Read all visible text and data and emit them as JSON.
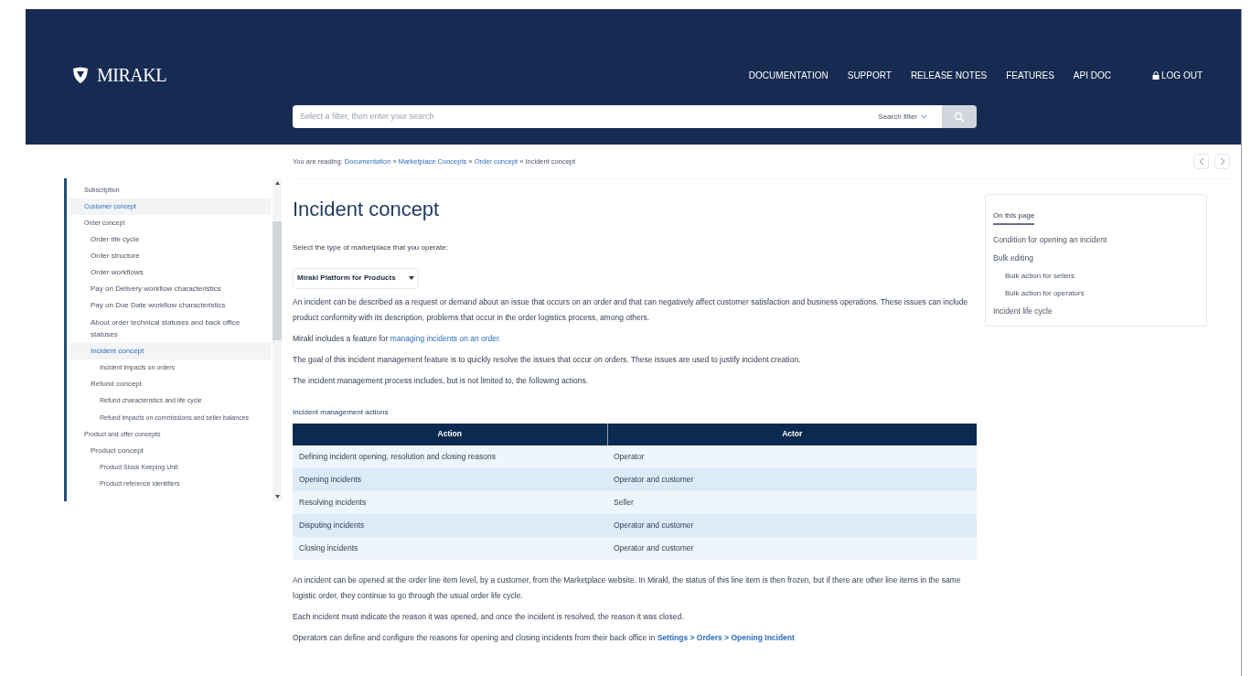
{
  "header": {
    "logo": "MIRAKL",
    "nav": [
      {
        "label": "DOCUMENTATION",
        "kind": "link"
      },
      {
        "label": "SUPPORT",
        "kind": "link"
      },
      {
        "label": "RELEASE NOTES",
        "kind": "link"
      },
      {
        "label": "FEATURES",
        "kind": "link"
      },
      {
        "label": "API DOC",
        "kind": "link"
      },
      {
        "label": "LOG OUT",
        "kind": "logout"
      }
    ],
    "search": {
      "placeholder": "Select a filter, then enter your search",
      "filter": "Search filter"
    }
  },
  "breadcrumb": {
    "prefix": "You are reading:",
    "links": [
      "Documentation",
      "Marketplace Concepts",
      "Order concept"
    ],
    "current": "Incident concept",
    "separator": "»"
  },
  "sidebar": {
    "items": [
      {
        "label": "Subscription",
        "highlighted": false
      },
      {
        "label": "Customer concept",
        "highlighted": true
      },
      {
        "label": "Order concept",
        "highlighted": false,
        "children": [
          {
            "label": "Order life cycle",
            "highlighted": false
          },
          {
            "label": "Order structure",
            "highlighted": false
          },
          {
            "label": "Order workflows",
            "highlighted": false
          },
          {
            "label": "Pay on Delivery workflow characteristics",
            "highlighted": false
          },
          {
            "label": "Pay on Due Date workflow characteristics",
            "highlighted": false
          },
          {
            "label": "About order technical statuses and back office statuses",
            "highlighted": false
          },
          {
            "label": "Incident concept",
            "highlighted": true,
            "children": [
              {
                "label": "Incident impacts on orders",
                "highlighted": false
              }
            ]
          },
          {
            "label": "Refund concept",
            "highlighted": false,
            "children": [
              {
                "label": "Refund characteristics and life cycle",
                "highlighted": false
              },
              {
                "label": "Refund impacts on commissions and seller balances",
                "highlighted": false
              }
            ]
          }
        ]
      },
      {
        "label": "Product and offer concepts",
        "highlighted": false,
        "children": [
          {
            "label": "Product concept",
            "highlighted": false,
            "children": [
              {
                "label": "Product Stock Keeping Unit",
                "highlighted": false
              },
              {
                "label": "Product reference identifiers",
                "highlighted": false
              }
            ]
          }
        ]
      }
    ]
  },
  "article": {
    "title": "Incident concept",
    "select_label": "Select the type of marketplace that you operate:",
    "select_value": "Mirakl Platform for Products",
    "paragraphs_top": [
      {
        "text": "An incident can be described as a request or demand about an issue that occurs on an order and that can negatively affect customer satisfaction and business operations. These issues can include product conformity with its description, problems that occur in the order logistics process, among others."
      },
      {
        "text": "Mirakl includes a feature for",
        "link": "managing incidents on an order."
      },
      {
        "text": "The goal of this incident management feature is to quickly resolve the issues that occur on orders. These issues are used to justify incident creation."
      },
      {
        "text": "The incident management process includes, but is not limited to, the following actions."
      }
    ],
    "table": {
      "caption": "Incident management actions",
      "columns": [
        "Action",
        "Actor"
      ],
      "rows": [
        [
          "Defining incident opening, resolution and closing reasons",
          "Operator"
        ],
        [
          "Opening incidents",
          "Operator and customer"
        ],
        [
          "Resolving incidents",
          "Seller"
        ],
        [
          "Disputing incidents",
          "Operator and customer"
        ],
        [
          "Closing incidents",
          "Operator and customer"
        ]
      ]
    },
    "paragraphs_bottom": [
      {
        "text": "An incident can be opened at the order line item level, by a customer, from the Marketplace website. In Mirakl, the status of this line item is then frozen, but if there are other line items in the same logistic order, they continue to go through the usual order life cycle."
      },
      {
        "text": "Each incident must indicate the reason it was opened, and once the incident is resolved, the reason it was closed."
      },
      {
        "text": "Operators can define and configure the reasons for opening and closing incidents from their back office in",
        "link": "Settings > Orders > Opening Incident"
      }
    ]
  },
  "toc": {
    "title": "On this page",
    "items": [
      {
        "label": "Condition for opening an incident"
      },
      {
        "label": "Bulk editing",
        "children": [
          {
            "label": "Bulk action for sellers"
          },
          {
            "label": "Bulk action for operators"
          }
        ]
      },
      {
        "label": "Incident life cycle"
      }
    ]
  }
}
